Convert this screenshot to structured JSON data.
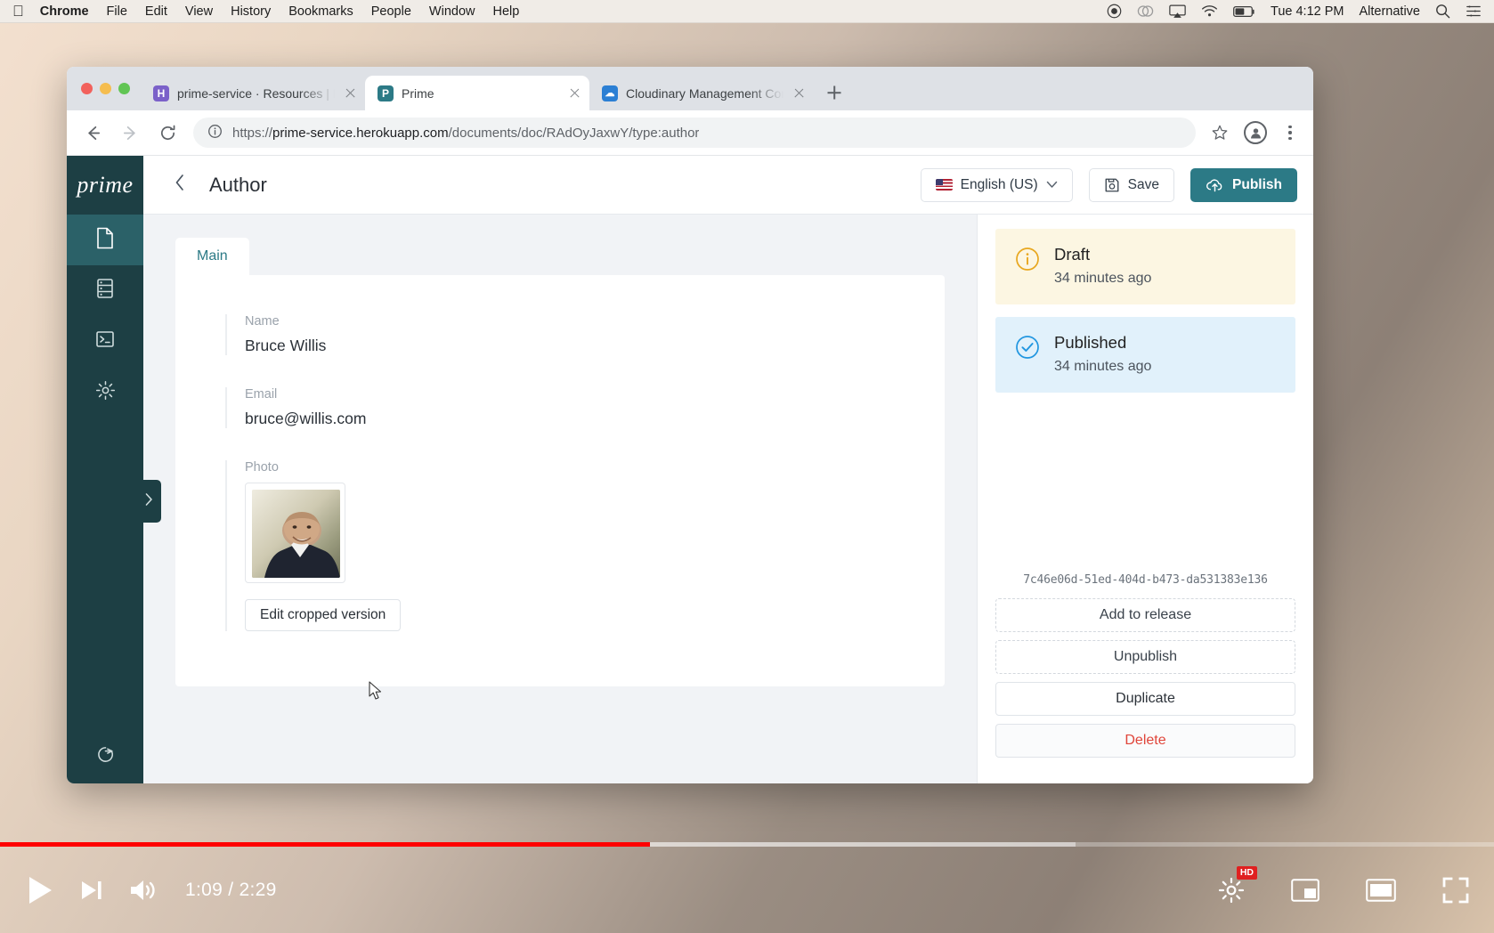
{
  "menubar": {
    "apple_icon": "apple-logo-icon",
    "items": [
      {
        "label": "Chrome",
        "bold": true
      },
      {
        "label": "File",
        "bold": false
      },
      {
        "label": "Edit",
        "bold": false
      },
      {
        "label": "View",
        "bold": false
      },
      {
        "label": "History",
        "bold": false
      },
      {
        "label": "Bookmarks",
        "bold": false
      },
      {
        "label": "People",
        "bold": false
      },
      {
        "label": "Window",
        "bold": false
      },
      {
        "label": "Help",
        "bold": false
      }
    ],
    "status_icons": [
      "record-icon",
      "creative-cloud-icon",
      "airplay-icon",
      "wifi-icon",
      "battery-icon"
    ],
    "clock": "Tue 4:12 PM",
    "user": "Alternative",
    "search_icon": "search-icon",
    "control_center_icon": "list-icon"
  },
  "browser": {
    "tabs": [
      {
        "title": "prime-service · Resources | He",
        "favicon_letter": "H",
        "favicon_color": "#7b61c9",
        "active": false
      },
      {
        "title": "Prime",
        "favicon_letter": "P",
        "favicon_color": "#2c7a86",
        "active": true
      },
      {
        "title": "Cloudinary Management Conso",
        "favicon_letter": "☁",
        "favicon_color": "#2b7fd4",
        "active": false
      }
    ],
    "new_tab_label": "New Tab",
    "nav": {
      "back": "back-icon",
      "forward": "forward-icon",
      "reload": "reload-icon"
    },
    "url_scheme": "https://",
    "url_host": "prime-service.herokuapp.com",
    "url_path": "/documents/doc/RAdOyJaxwY/type:author",
    "info_icon": "info-icon",
    "bookmark_icon": "star-icon",
    "profile_icon": "profile-icon",
    "menu_icon": "kebab-menu-icon"
  },
  "studio": {
    "logo": "prime",
    "nav_items": [
      {
        "name": "desk-tool",
        "icon": "document-icon",
        "active": true
      },
      {
        "name": "media-tool",
        "icon": "database-icon",
        "active": false
      },
      {
        "name": "vision-tool",
        "icon": "terminal-icon",
        "active": false
      },
      {
        "name": "settings-tool",
        "icon": "gear-icon",
        "active": false
      }
    ],
    "collapse_icon": "chevron-right-icon",
    "bottom_icon": "sign-out-icon",
    "topbar": {
      "back_icon": "chevron-left-icon",
      "title": "Author",
      "language_label": "English (US)",
      "language_flag": "us-flag-icon",
      "language_chevron": "chevron-down-icon",
      "save_label": "Save",
      "save_icon": "floppy-disk-icon",
      "publish_label": "Publish",
      "publish_icon": "cloud-upload-icon",
      "publish_color": "#2c7a86"
    },
    "tabs": [
      {
        "label": "Main",
        "active": true
      }
    ],
    "fields": [
      {
        "label": "Name",
        "value": "Bruce Willis",
        "type": "text"
      },
      {
        "label": "Email",
        "value": "bruce@willis.com",
        "type": "text"
      },
      {
        "label": "Photo",
        "value": "",
        "type": "image"
      }
    ],
    "crop_button_label": "Edit cropped version",
    "cursor_icon": "pointer-cursor-icon"
  },
  "statuspane": {
    "cards": [
      {
        "status": "Draft",
        "timestamp": "34 minutes ago",
        "icon": "info-circle-icon",
        "accent": "#e8a71f",
        "bg": "#fcf6e2"
      },
      {
        "status": "Published",
        "timestamp": "34 minutes ago",
        "icon": "check-circle-icon",
        "accent": "#2196e0",
        "bg": "#e1f1fb"
      }
    ],
    "document_id": "7c46e06d-51ed-404d-b473-da531383e136",
    "actions": [
      {
        "label": "Add to release",
        "style": "dashed"
      },
      {
        "label": "Unpublish",
        "style": "dashed"
      },
      {
        "label": "Duplicate",
        "style": "solid"
      },
      {
        "label": "Delete",
        "style": "danger"
      }
    ]
  },
  "player": {
    "current_time": "1:09",
    "duration": "2:29",
    "time_display": "1:09 / 2:29",
    "progress_percent": 43.5,
    "loaded_percent": 72,
    "progress_color": "#ff0000",
    "play_icon": "play-icon",
    "next_icon": "next-track-icon",
    "volume_icon": "volume-icon",
    "settings_icon": "settings-gear-icon",
    "quality_badge": "HD",
    "miniplayer_icon": "miniplayer-icon",
    "theater_icon": "theater-mode-icon",
    "fullscreen_icon": "fullscreen-icon"
  }
}
